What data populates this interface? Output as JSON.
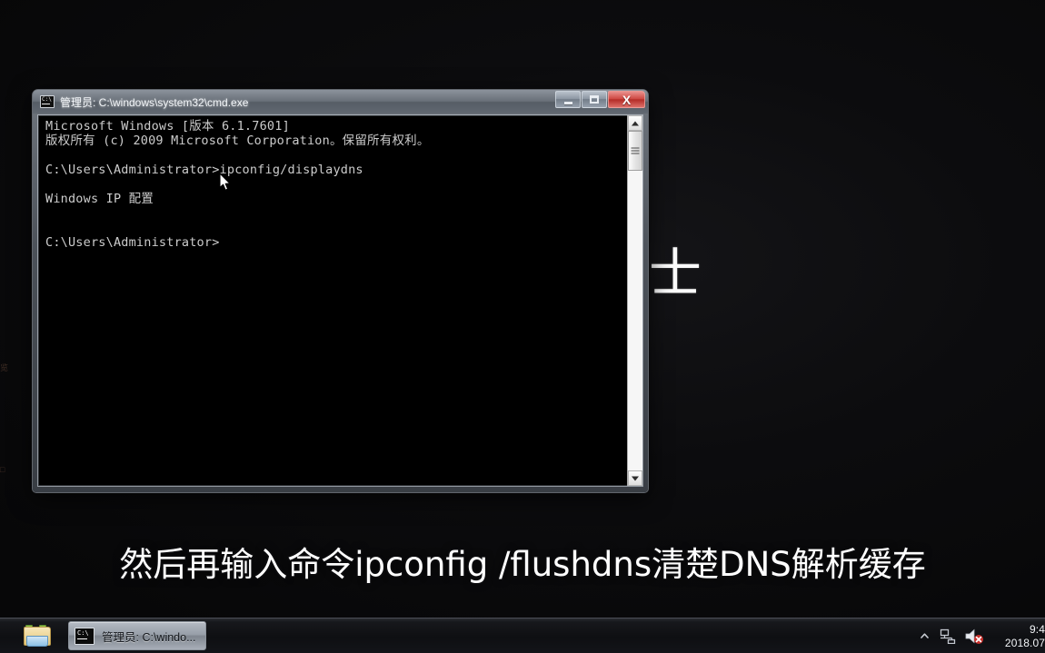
{
  "window": {
    "title": "管理员: C:\\windows\\system32\\cmd.exe",
    "icon": "cmd-icon",
    "buttons": {
      "minimize": "—",
      "maximize": "□",
      "close": "X"
    }
  },
  "console": {
    "lines": [
      "Microsoft Windows [版本 6.1.7601]",
      "版权所有 (c) 2009 Microsoft Corporation。保留所有权利。",
      "",
      "C:\\Users\\Administrator>ipconfig/displaydns",
      "",
      "Windows IP 配置",
      "",
      "",
      "C:\\Users\\Administrator>"
    ]
  },
  "desktop": {
    "watermark_char": "士",
    "ghost_icons": [
      "览",
      "□"
    ]
  },
  "subtitle": {
    "text": "然后再输入命令ipconfig /flushdns清楚DNS解析缓存"
  },
  "taskbar": {
    "explorer_label": "Windows 资源管理器",
    "cmd_button_label": "管理员: C:\\windo...",
    "tray": {
      "show_hidden": "▲",
      "network": "network-icon",
      "volume": "volume-muted-icon"
    },
    "clock": {
      "time": "9:4",
      "date": "2018.07"
    }
  },
  "colors": {
    "close_button": "#cf4b45",
    "console_bg": "#000000",
    "console_text": "#cccccc",
    "taskbar_bg": "#0e0f12"
  }
}
